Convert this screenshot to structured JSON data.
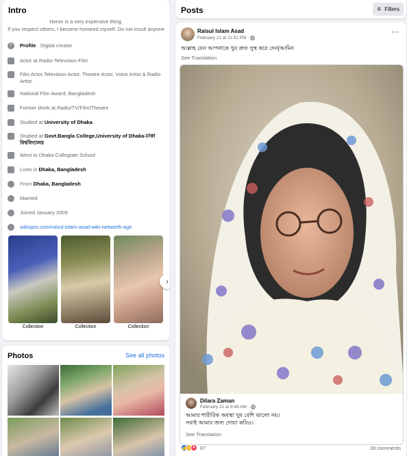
{
  "intro": {
    "title": "Intro",
    "bio_line1": "Honor is a very expensive thing.",
    "bio_line2": "If you respect others, I become honored myself. Do not insult anyone",
    "items": [
      {
        "icon": "info-icon",
        "bold": "Profile",
        "text": " · Digital creator"
      },
      {
        "icon": "briefcase-icon",
        "text": "Actor at Radio-Television-Film"
      },
      {
        "icon": "briefcase-icon",
        "text": "Film Actor,Television Actor, Theatre Actor, Voice Artist & Radio Artist."
      },
      {
        "icon": "briefcase-icon",
        "text": "National Flim Award, Bangladesh"
      },
      {
        "icon": "briefcase-icon",
        "text": "Former Work at Radio/TV/Film/Theatre"
      },
      {
        "icon": "graduation-cap-icon",
        "text": "Studied at ",
        "bold": "University of Dhaka"
      },
      {
        "icon": "graduation-cap-icon",
        "text": "Studied at ",
        "bold": "Govt.Bangla College,University of Dhaka-ঢাকা বিশ্ববিদ্যালয়"
      },
      {
        "icon": "graduation-cap-icon",
        "text": "Went to Dhaka Collegiate School"
      },
      {
        "icon": "home-icon",
        "text": "Lives in ",
        "bold": "Dhaka, Bangladesh"
      },
      {
        "icon": "location-pin-icon",
        "text": "From ",
        "bold": "Dhaka, Bangladesh"
      },
      {
        "icon": "heart-icon",
        "text": "Married"
      },
      {
        "icon": "clock-icon",
        "text": "Joined January 2009"
      },
      {
        "icon": "globe-icon",
        "link": "wikispro.com/raisul-islam-asad-wiki-networth-age"
      }
    ],
    "collections": [
      {
        "label": "Collection"
      },
      {
        "label": "Collection"
      },
      {
        "label": "Collection"
      }
    ],
    "next_icon": "›"
  },
  "photos": {
    "title": "Photos",
    "see_all": "See all photos"
  },
  "posts": {
    "title": "Posts",
    "filters_label": "Filters",
    "filters_icon": "⚟"
  },
  "post": {
    "author": "Raisul Islam Asad",
    "time": "February 21 at 11:51 PM ·",
    "privacy_icon": "globe-icon",
    "more": "···",
    "text": "আল্লাহ যেন আপনাকে খুব দ্রুত সুস্থ করে দেন|আমিন",
    "see_translation": "See Translation",
    "shared_author": "Dilara Zaman",
    "shared_time": "February 21 at 8:48 AM ·",
    "shared_line1": "আমার শারীরিক অবস্থা খুব বেশি ভালো নয়।",
    "shared_line2": "সবাই আমার জন্য দোয়া করিও।",
    "shared_see_translation": "See Translation",
    "reaction_count": "87",
    "comments": "28 comments",
    "reaction_colors": [
      "#1877f2",
      "#f7b125",
      "#f33e58"
    ]
  }
}
